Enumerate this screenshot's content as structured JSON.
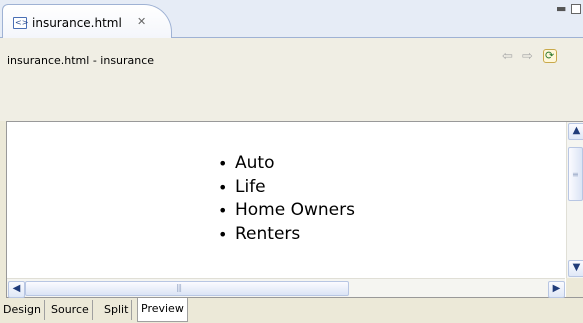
{
  "editor_tab": {
    "label": "insurance.html",
    "close_glyph": "✕",
    "icon": "html-file-icon"
  },
  "header": {
    "title": "insurance.html - insurance",
    "icons": [
      "back-arrow-icon",
      "forward-arrow-icon",
      "refresh-icon"
    ]
  },
  "preview": {
    "list_items": [
      "Auto",
      "Life",
      "Home Owners",
      "Renters"
    ]
  },
  "mode_tabs": [
    {
      "label": "Design"
    },
    {
      "label": "Source"
    },
    {
      "label": "Split"
    },
    {
      "label": "Preview",
      "active": true
    }
  ],
  "colors": {
    "tab_border": "#9fb2d4",
    "scrollbar_accent": "#b8c6e3",
    "panel_bg": "#ece9d8"
  }
}
